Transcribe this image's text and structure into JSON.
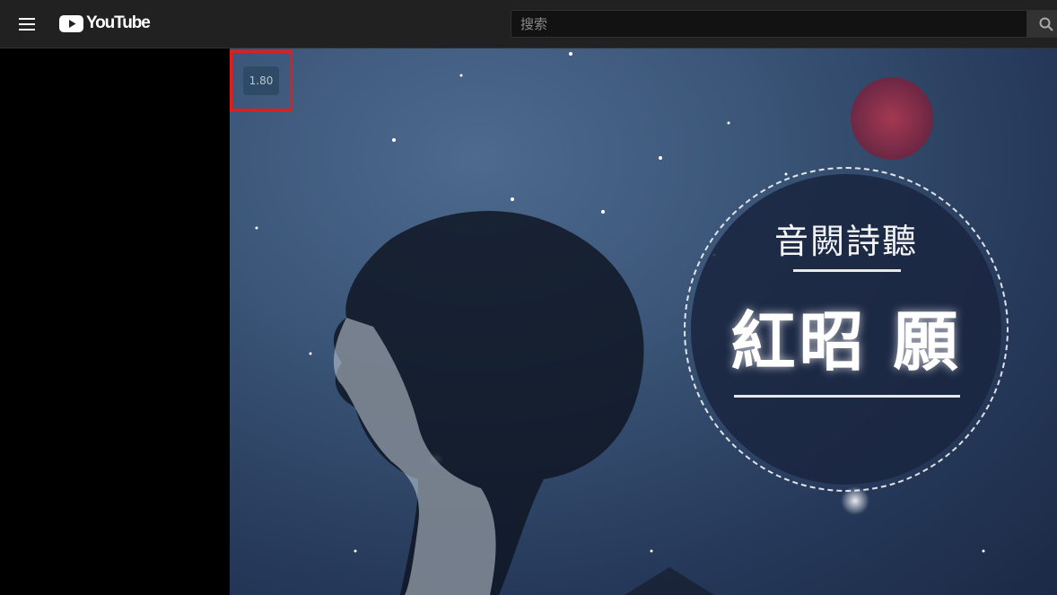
{
  "header": {
    "menu_icon": "hamburger-menu-icon",
    "logo_text": "YouTube",
    "logo_icon": "youtube-play-icon",
    "search_placeholder": "搜索",
    "search_icon": "search-icon"
  },
  "player": {
    "playback_speed": "1.80",
    "highlight_color": "#e01e1e",
    "cover_subtitle": "音闕詩聽",
    "cover_title": "紅昭 願"
  },
  "colors": {
    "topbar": "#212121",
    "brand_red": "#ff0000",
    "video_bg": "#2f4668"
  }
}
